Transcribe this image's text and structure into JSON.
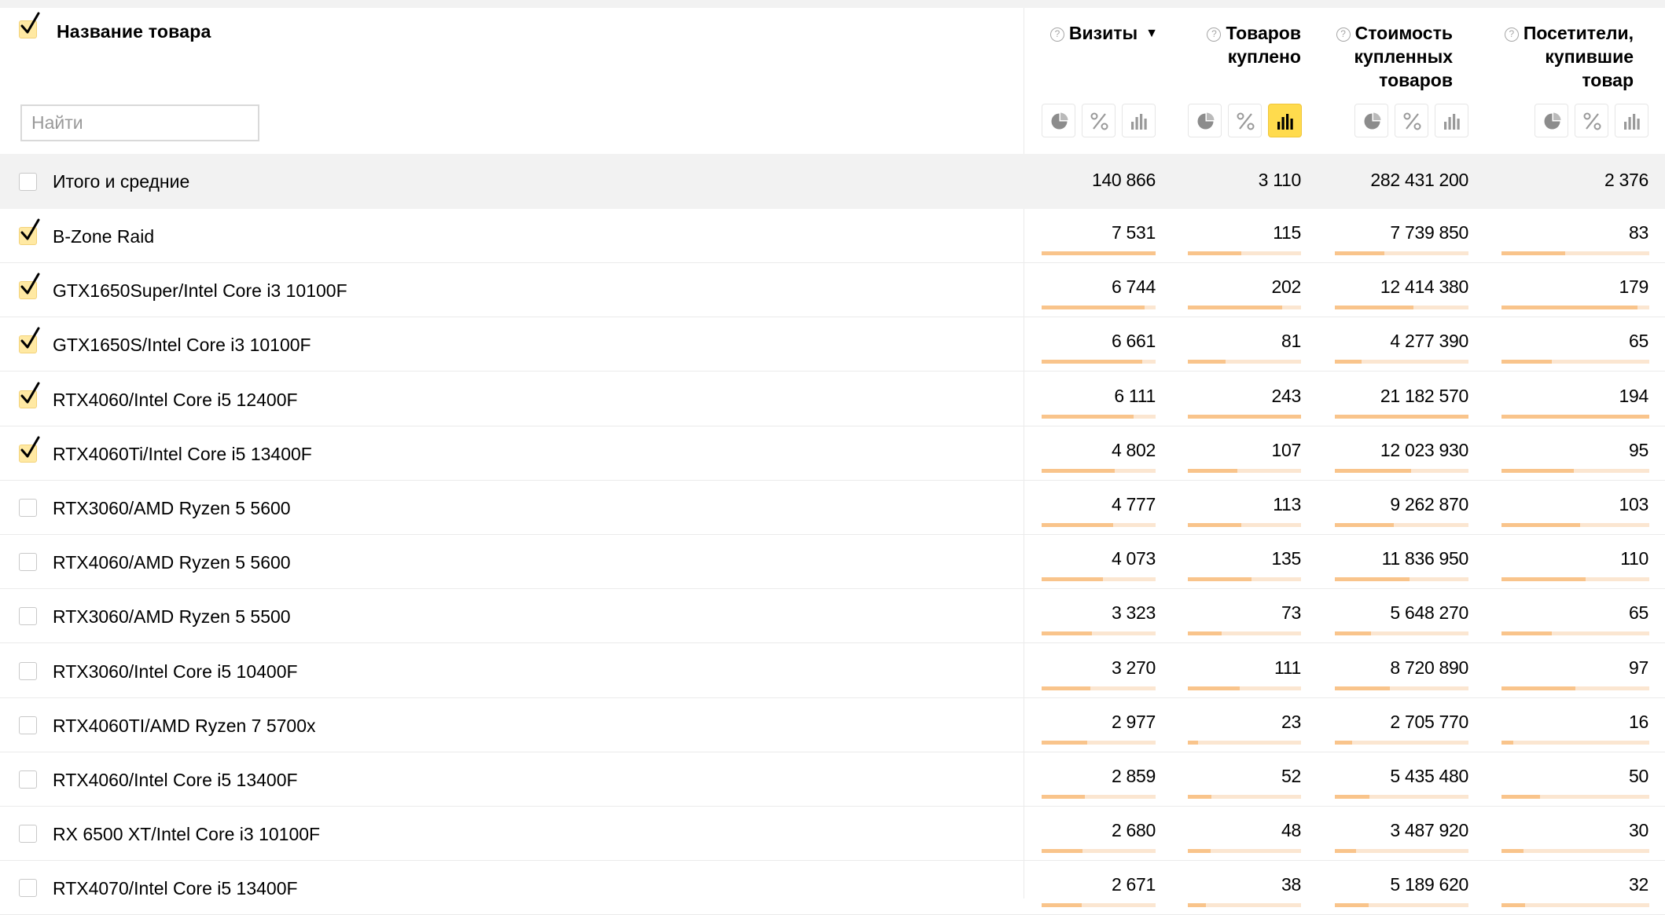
{
  "header": {
    "select_all_checked": true,
    "name_column_label": "Название товара",
    "search_placeholder": "Найти",
    "columns": [
      {
        "key": "visits",
        "label": "Визиты",
        "sort_indicator": "▼",
        "active_view": "none"
      },
      {
        "key": "items_bought",
        "label_line1": "Товаров",
        "label_line2": "куплено",
        "active_view": "bars"
      },
      {
        "key": "cost",
        "label_line1": "Стоимость",
        "label_line2": "купленных",
        "label_line3": "товаров",
        "active_view": "none"
      },
      {
        "key": "buyers",
        "label_line1": "Посетители,",
        "label_line2": "купившие",
        "label_line3": "товар",
        "active_view": "none"
      }
    ],
    "view_icons": [
      "pie-chart-icon",
      "percent-icon",
      "bar-chart-icon"
    ],
    "help_icon": "?"
  },
  "totals": {
    "label": "Итого и средние",
    "checked": false,
    "visits": "140 866",
    "items_bought": "3 110",
    "cost": "282 431 200",
    "buyers": "2 376"
  },
  "rows": [
    {
      "name": "B-Zone Raid",
      "checked": true,
      "visits": "7 531",
      "items_bought": "115",
      "cost": "7 739 850",
      "buyers": "83",
      "visits_share": 1.0,
      "items_share": 0.47,
      "cost_share": 0.37,
      "buyers_share": 0.43
    },
    {
      "name": "GTX1650Super/Intel Core i3 10100F",
      "checked": true,
      "visits": "6 744",
      "items_bought": "202",
      "cost": "12 414 380",
      "buyers": "179",
      "visits_share": 0.9,
      "items_share": 0.83,
      "cost_share": 0.59,
      "buyers_share": 0.92
    },
    {
      "name": "GTX1650S/Intel Core i3 10100F",
      "checked": true,
      "visits": "6 661",
      "items_bought": "81",
      "cost": "4 277 390",
      "buyers": "65",
      "visits_share": 0.88,
      "items_share": 0.33,
      "cost_share": 0.2,
      "buyers_share": 0.34
    },
    {
      "name": "RTX4060/Intel Core i5 12400F",
      "checked": true,
      "visits": "6 111",
      "items_bought": "243",
      "cost": "21 182 570",
      "buyers": "194",
      "visits_share": 0.81,
      "items_share": 1.0,
      "cost_share": 1.0,
      "buyers_share": 1.0
    },
    {
      "name": "RTX4060Ti/Intel Core i5 13400F",
      "checked": true,
      "visits": "4 802",
      "items_bought": "107",
      "cost": "12 023 930",
      "buyers": "95",
      "visits_share": 0.64,
      "items_share": 0.44,
      "cost_share": 0.57,
      "buyers_share": 0.49
    },
    {
      "name": "RTX3060/AMD Ryzen 5 5600",
      "checked": false,
      "visits": "4 777",
      "items_bought": "113",
      "cost": "9 262 870",
      "buyers": "103",
      "visits_share": 0.63,
      "items_share": 0.47,
      "cost_share": 0.44,
      "buyers_share": 0.53
    },
    {
      "name": "RTX4060/AMD Ryzen 5 5600",
      "checked": false,
      "visits": "4 073",
      "items_bought": "135",
      "cost": "11 836 950",
      "buyers": "110",
      "visits_share": 0.54,
      "items_share": 0.56,
      "cost_share": 0.56,
      "buyers_share": 0.57
    },
    {
      "name": "RTX3060/AMD Ryzen 5 5500",
      "checked": false,
      "visits": "3 323",
      "items_bought": "73",
      "cost": "5 648 270",
      "buyers": "65",
      "visits_share": 0.44,
      "items_share": 0.3,
      "cost_share": 0.27,
      "buyers_share": 0.34
    },
    {
      "name": "RTX3060/Intel Core i5 10400F",
      "checked": false,
      "visits": "3 270",
      "items_bought": "111",
      "cost": "8 720 890",
      "buyers": "97",
      "visits_share": 0.43,
      "items_share": 0.46,
      "cost_share": 0.41,
      "buyers_share": 0.5
    },
    {
      "name": "RTX4060TI/AMD Ryzen 7 5700x",
      "checked": false,
      "visits": "2 977",
      "items_bought": "23",
      "cost": "2 705 770",
      "buyers": "16",
      "visits_share": 0.4,
      "items_share": 0.09,
      "cost_share": 0.13,
      "buyers_share": 0.08
    },
    {
      "name": "RTX4060/Intel Core i5 13400F",
      "checked": false,
      "visits": "2 859",
      "items_bought": "52",
      "cost": "5 435 480",
      "buyers": "50",
      "visits_share": 0.38,
      "items_share": 0.21,
      "cost_share": 0.26,
      "buyers_share": 0.26
    },
    {
      "name": "RX 6500 XT/Intel Core i3 10100F",
      "checked": false,
      "visits": "2 680",
      "items_bought": "48",
      "cost": "3 487 920",
      "buyers": "30",
      "visits_share": 0.36,
      "items_share": 0.2,
      "cost_share": 0.16,
      "buyers_share": 0.15
    },
    {
      "name": "RTX4070/Intel Core i5 13400F",
      "checked": false,
      "visits": "2 671",
      "items_bought": "38",
      "cost": "5 189 620",
      "buyers": "32",
      "visits_share": 0.35,
      "items_share": 0.16,
      "cost_share": 0.25,
      "buyers_share": 0.16
    }
  ],
  "colors": {
    "checkbox_checked_bg": "#ffe9a3",
    "active_button": "#ffdb4d",
    "bar_fill": "#f9c48b",
    "bar_track": "#fbe6d1",
    "totals_bg": "#f2f2f2"
  }
}
